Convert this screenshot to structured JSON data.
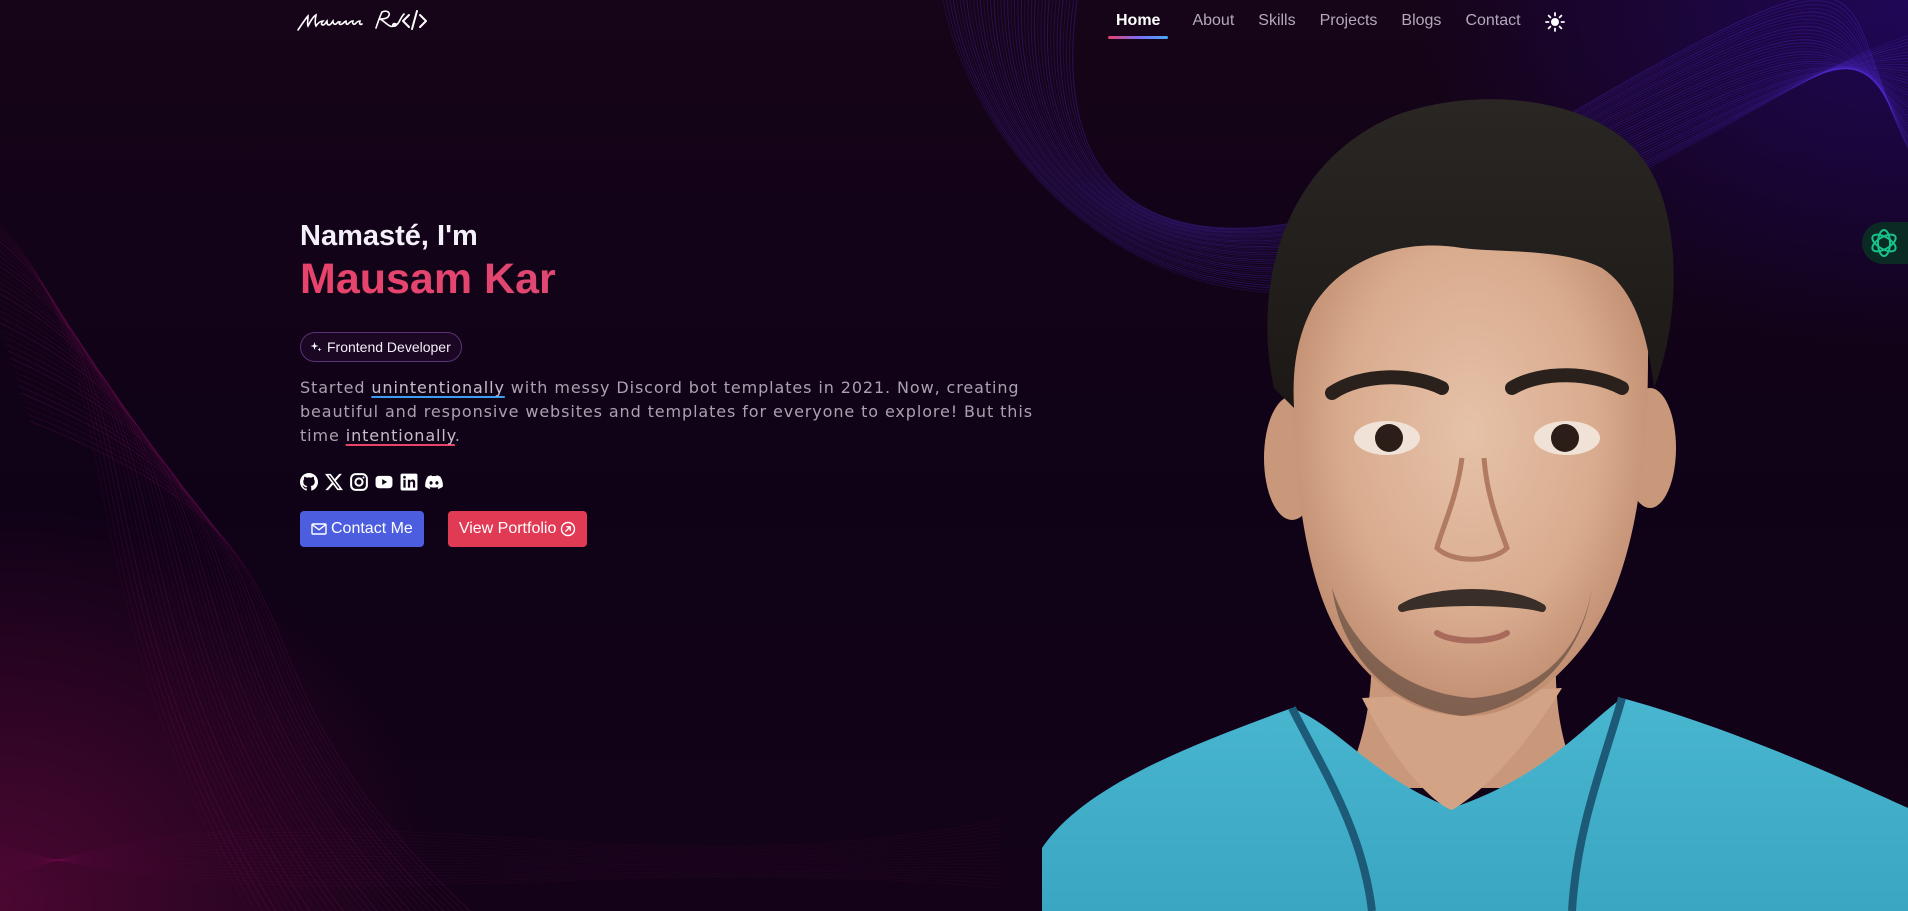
{
  "nav": {
    "logo_text": "Mausam Kar</>",
    "items": [
      {
        "label": "Home",
        "active": true
      },
      {
        "label": "About",
        "active": false
      },
      {
        "label": "Skills",
        "active": false
      },
      {
        "label": "Projects",
        "active": false
      },
      {
        "label": "Blogs",
        "active": false
      },
      {
        "label": "Contact",
        "active": false
      }
    ],
    "theme_icon": "sun-icon"
  },
  "hero": {
    "greeting": "Namasté, I'm",
    "name": "Mausam Kar",
    "role": "Frontend Developer",
    "intro": {
      "part1": "Started ",
      "highlight1": "unintentionally",
      "part2": " with messy Discord bot templates in 2021. Now, creating beautiful and responsive websites and templates for everyone to explore! But this time ",
      "highlight2": "intentionally",
      "part3": "."
    },
    "socials": [
      "github-icon",
      "x-icon",
      "instagram-icon",
      "youtube-icon",
      "linkedin-icon",
      "discord-icon"
    ],
    "buttons": {
      "contact": "Contact Me",
      "portfolio": "View Portfolio"
    }
  },
  "colors": {
    "background": "#0f0217",
    "accent_name": "#e0466e",
    "contact_button": "#4c5de0",
    "portfolio_button": "#e13a55",
    "assistant": "#18c28a"
  },
  "assistant_icon": "ai-assistant-icon"
}
